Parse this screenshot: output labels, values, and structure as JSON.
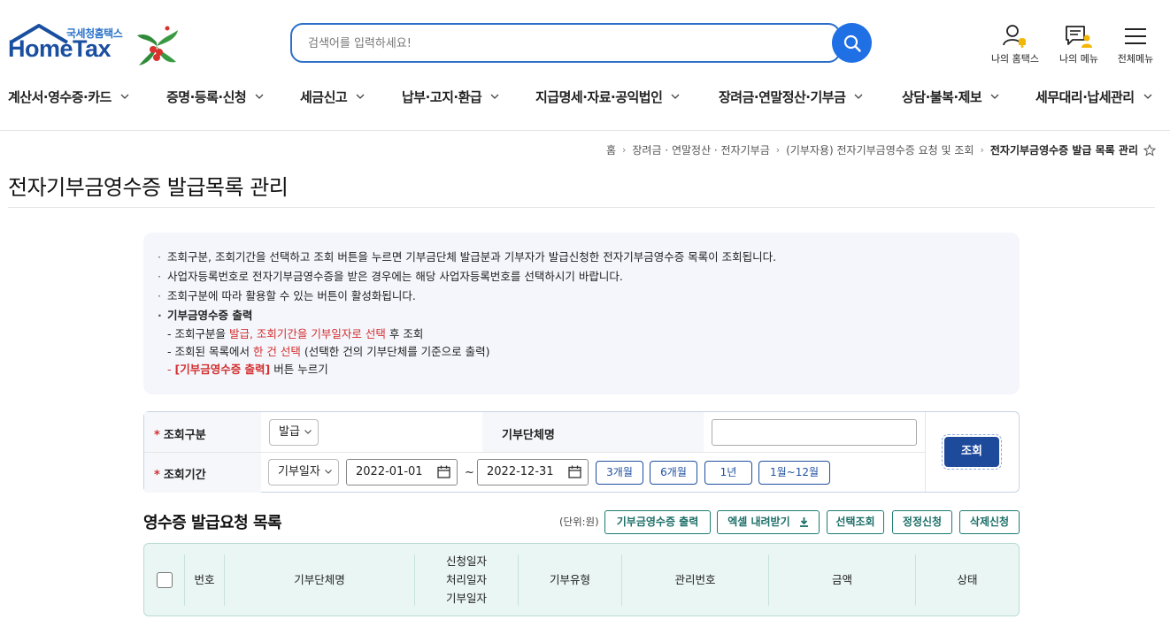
{
  "header": {
    "logo_sub": "국세청홈택스",
    "logo_main": "HomeTax",
    "search_placeholder": "검색어를 입력하세요!",
    "util": [
      "나의 홈택스",
      "나의 메뉴",
      "전체메뉴"
    ]
  },
  "gnb": [
    "계산서·영수증·카드",
    "증명·등록·신청",
    "세금신고",
    "납부·고지·환급",
    "지급명세·자료·공익법인",
    "장려금·연말정산·기부금",
    "상담·불복·제보",
    "세무대리·납세관리"
  ],
  "breadcrumb": [
    "홈",
    "장려금 · 연말정산 · 전자기부금",
    "(기부자용) 전자기부금영수증 요청 및 조회",
    "전자기부금영수증 발급 목록 관리"
  ],
  "page_title": "전자기부금영수증 발급목록 관리",
  "info": {
    "line1": "조회구분, 조회기간을 선택하고 조회 버튼을 누르면 기부금단체 발급분과 기부자가 발급신청한 전자기부금영수증 목록이 조회됩니다.",
    "line2": "사업자등록번호로 전자기부금영수증을 받은 경우에는 해당 사업자등록번호를 선택하시기 바랍니다.",
    "line3": "조회구분에 따라 활용할 수 있는 버튼이 활성화됩니다.",
    "line4": "기부금영수증 출력",
    "sub1_a": "- 조회구분을 ",
    "sub1_b": "발급, 조회기간을 기부일자로 선택",
    "sub1_c": " 후 조회",
    "sub2_a": "- 조회된 목록에서 ",
    "sub2_b": "한 건 선택",
    "sub2_c": " (선택한 건의 기부단체를 기준으로 출력)",
    "sub3_a": "- ",
    "sub3_b": "[기부금영수증 출력]",
    "sub3_c": " 버튼 누르기"
  },
  "form": {
    "label_type": "조회구분",
    "type_value": "발급",
    "label_org": "기부단체명",
    "org_value": "",
    "label_period": "조회기간",
    "period_type": "기부일자",
    "date_from": "2022-01-01",
    "date_to": "2022-12-31",
    "tilde": "~",
    "period_buttons": [
      "3개월",
      "6개월",
      "1년",
      "1월~12월"
    ],
    "submit": "조회"
  },
  "list": {
    "title": "영수증 발급요청 목록",
    "unit": "(단위:원)",
    "buttons": [
      "기부금영수증 출력",
      "엑셀 내려받기",
      "선택조회",
      "정정신청",
      "삭제신청"
    ],
    "columns": [
      "번호",
      "기부단체명",
      "신청일자",
      "처리일자",
      "기부일자",
      "기부유형",
      "관리번호",
      "금액",
      "상태"
    ]
  }
}
